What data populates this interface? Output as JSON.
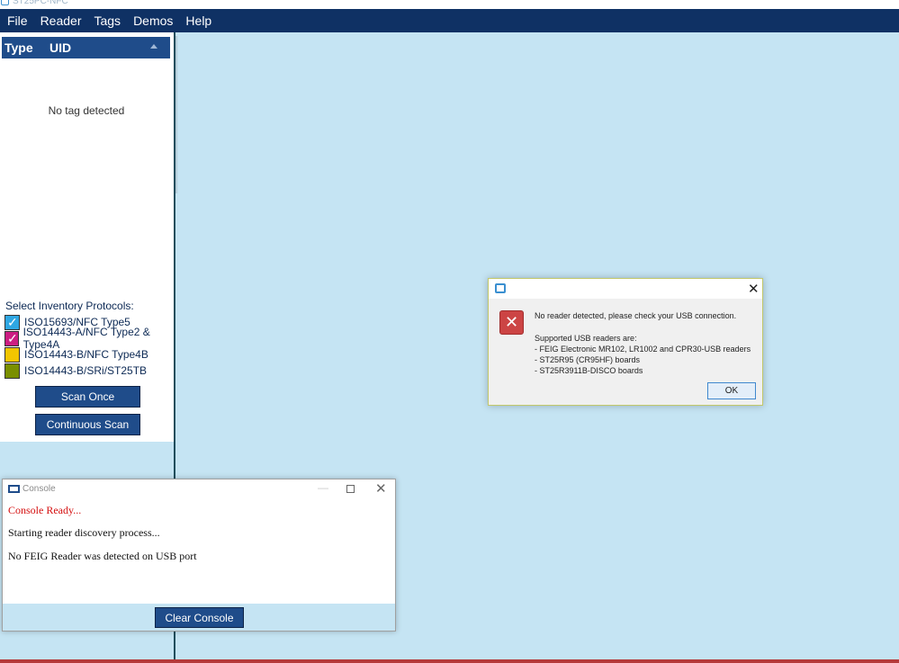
{
  "window": {
    "title": "ST25PC-NFC"
  },
  "menu": [
    "File",
    "Reader",
    "Tags",
    "Demos",
    "Help"
  ],
  "tag_list": {
    "col_type": "Type",
    "col_uid": "UID",
    "empty_message": "No tag detected"
  },
  "protocols": {
    "title": "Select Inventory Protocols:",
    "items": [
      {
        "label": "ISO15693/NFC Type5",
        "color": "#2fa7e3",
        "checked": true
      },
      {
        "label": "ISO14443-A/NFC Type2 & Type4A",
        "color": "#cc1d82",
        "checked": true
      },
      {
        "label": "ISO14443-B/NFC Type4B",
        "color": "#f2c500",
        "checked": false
      },
      {
        "label": "ISO14443-B/SRi/ST25TB",
        "color": "#7a8f00",
        "checked": false
      }
    ]
  },
  "buttons": {
    "scan_once": "Scan Once",
    "continuous_scan": "Continuous Scan"
  },
  "console": {
    "title": "Console",
    "lines": [
      {
        "text": "Console Ready...",
        "color": "#d40f0f"
      },
      {
        "text": "Starting reader discovery process...",
        "color": "#111111"
      },
      {
        "text": "No FEIG Reader was detected on USB port",
        "color": "#111111"
      }
    ],
    "clear_label": "Clear Console"
  },
  "dialog": {
    "message": "No reader detected, please check your USB connection.",
    "supported_title": "Supported USB readers are:",
    "supported": [
      " - FEIG Electronic MR102, LR1002 and CPR30-USB readers",
      " - ST25R95 (CR95HF) boards",
      " - ST25R3911B-DISCO boards"
    ],
    "ok_label": "OK"
  }
}
